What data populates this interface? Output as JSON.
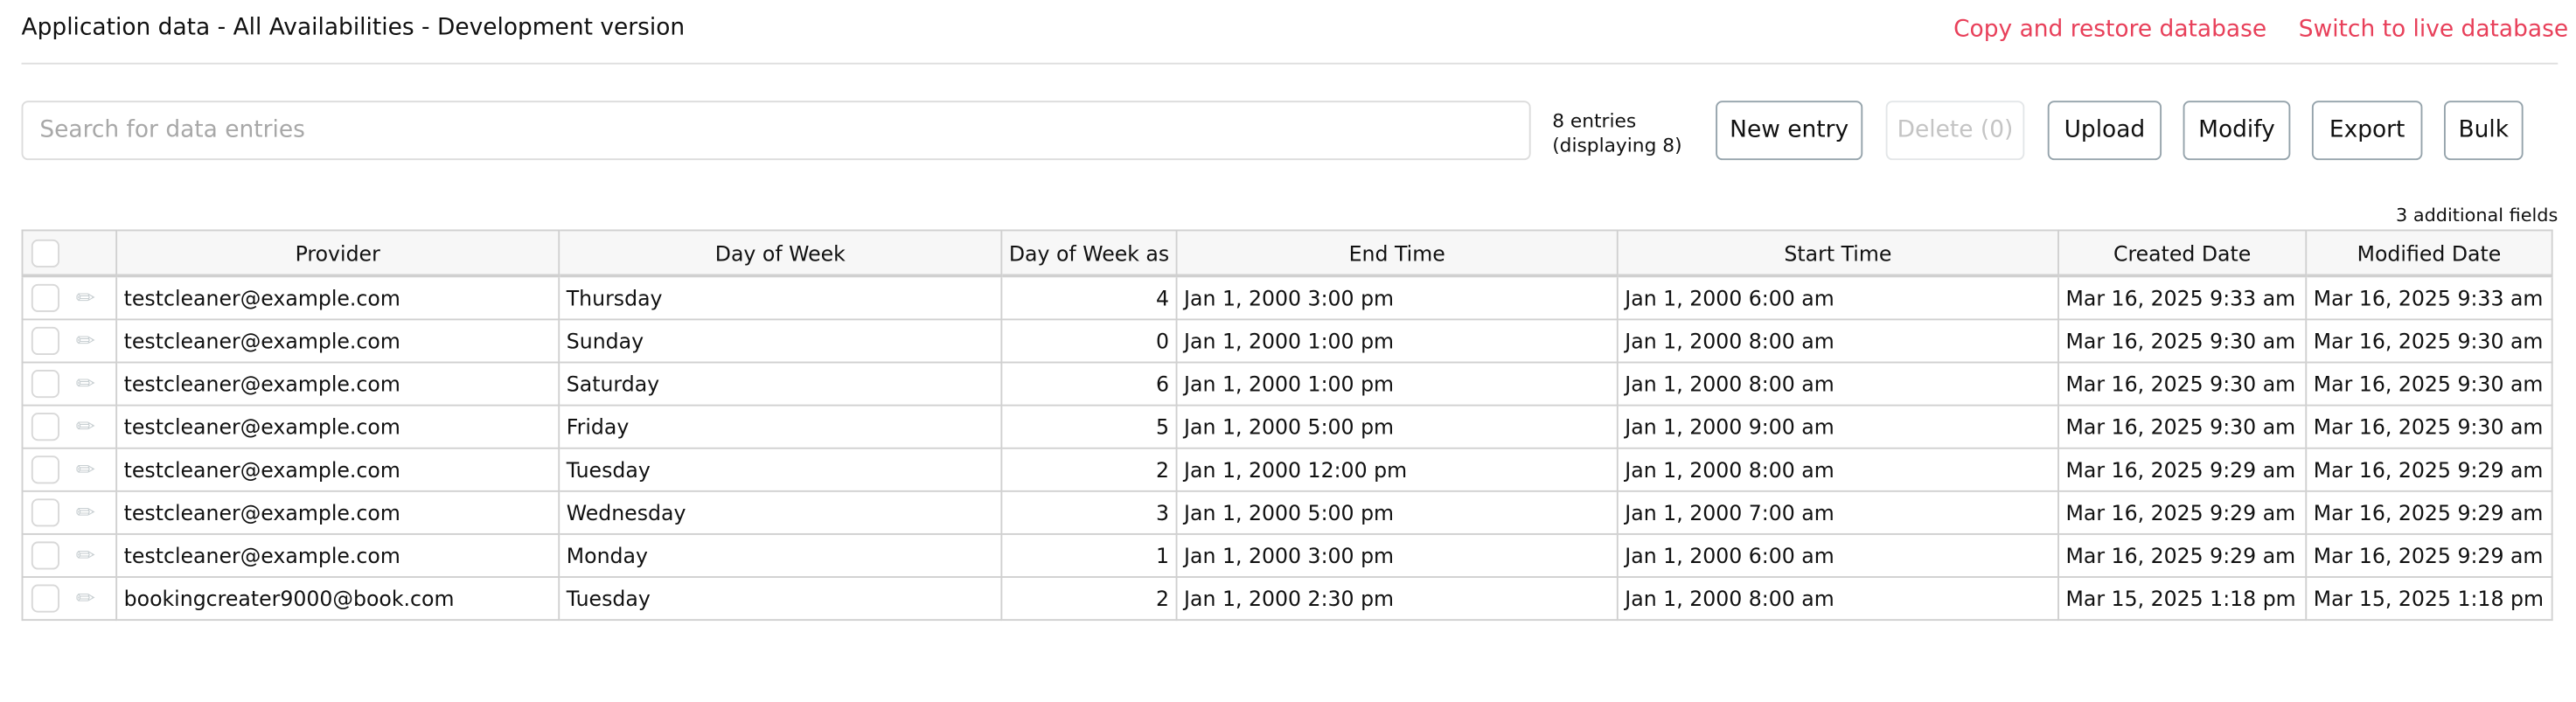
{
  "header": {
    "title": "Application data - All Availabilities - Development version",
    "links": [
      "Copy and restore database",
      "Switch to live database"
    ],
    "link_color": "#e8405a"
  },
  "search": {
    "placeholder": "Search for data entries",
    "value": ""
  },
  "count": {
    "line1": "8 entries",
    "line2": "(displaying 8)"
  },
  "toolbar": {
    "new_entry": "New entry",
    "delete": "Delete (0)",
    "upload": "Upload",
    "modify": "Modify",
    "export": "Export",
    "bulk": "Bulk"
  },
  "additional_fields": "3 additional fields",
  "table": {
    "columns": [
      "Provider",
      "Day of Week",
      "Day of Week as N",
      "End Time",
      "Start Time",
      "Created Date",
      "Modified Date"
    ],
    "rows": [
      [
        "testcleaner@example.com",
        "Thursday",
        "4",
        "Jan 1, 2000 3:00 pm",
        "Jan 1, 2000 6:00 am",
        "Mar 16, 2025 9:33 am",
        "Mar 16, 2025 9:33 am"
      ],
      [
        "testcleaner@example.com",
        "Sunday",
        "0",
        "Jan 1, 2000 1:00 pm",
        "Jan 1, 2000 8:00 am",
        "Mar 16, 2025 9:30 am",
        "Mar 16, 2025 9:30 am"
      ],
      [
        "testcleaner@example.com",
        "Saturday",
        "6",
        "Jan 1, 2000 1:00 pm",
        "Jan 1, 2000 8:00 am",
        "Mar 16, 2025 9:30 am",
        "Mar 16, 2025 9:30 am"
      ],
      [
        "testcleaner@example.com",
        "Friday",
        "5",
        "Jan 1, 2000 5:00 pm",
        "Jan 1, 2000 9:00 am",
        "Mar 16, 2025 9:30 am",
        "Mar 16, 2025 9:30 am"
      ],
      [
        "testcleaner@example.com",
        "Tuesday",
        "2",
        "Jan 1, 2000 12:00 pm",
        "Jan 1, 2000 8:00 am",
        "Mar 16, 2025 9:29 am",
        "Mar 16, 2025 9:29 am"
      ],
      [
        "testcleaner@example.com",
        "Wednesday",
        "3",
        "Jan 1, 2000 5:00 pm",
        "Jan 1, 2000 7:00 am",
        "Mar 16, 2025 9:29 am",
        "Mar 16, 2025 9:29 am"
      ],
      [
        "testcleaner@example.com",
        "Monday",
        "1",
        "Jan 1, 2000 3:00 pm",
        "Jan 1, 2000 6:00 am",
        "Mar 16, 2025 9:29 am",
        "Mar 16, 2025 9:29 am"
      ],
      [
        "bookingcreater9000@book.com",
        "Tuesday",
        "2",
        "Jan 1, 2000 2:30 pm",
        "Jan 1, 2000 8:00 am",
        "Mar 15, 2025 1:18 pm",
        "Mar 15, 2025 1:18 pm"
      ]
    ]
  },
  "icons": {
    "row_edit": "pencil-icon",
    "checkbox": "checkbox-icon"
  }
}
